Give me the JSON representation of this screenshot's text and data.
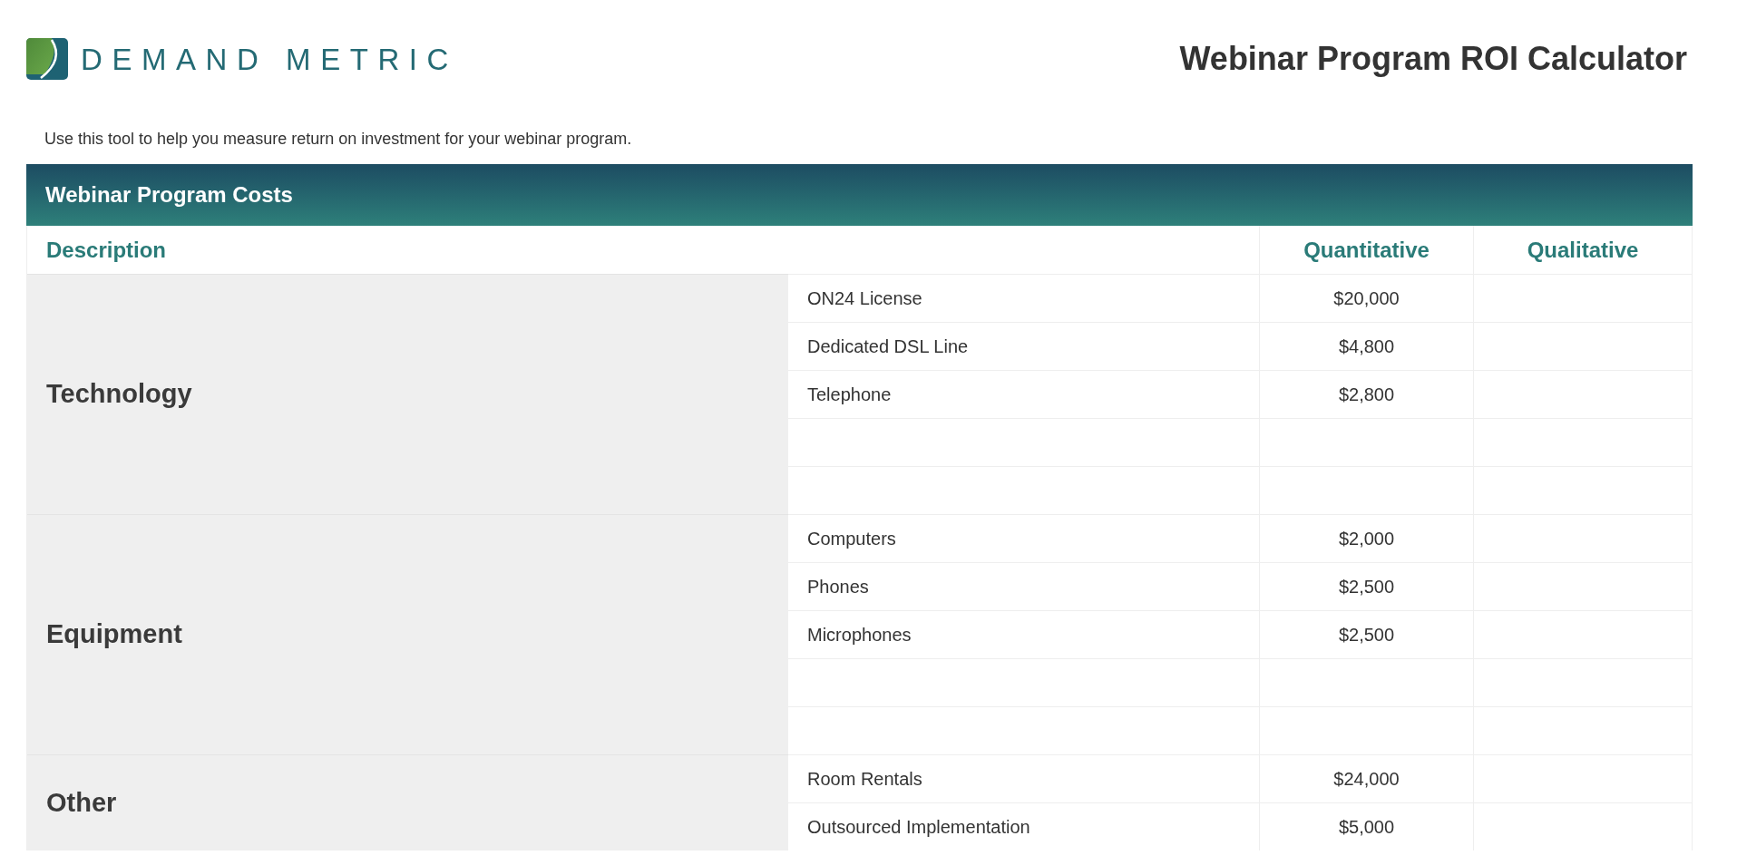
{
  "brand": {
    "name": "DEMAND METRIC"
  },
  "title": "Webinar Program ROI Calculator",
  "intro": "Use this tool to help you measure return on investment for your webinar program.",
  "section": {
    "title": "Webinar Program Costs",
    "columns": [
      "Description",
      "Quantitative",
      "Qualitative"
    ],
    "groups": [
      {
        "name": "Technology",
        "items": [
          {
            "kind": "entry",
            "name": "ON24 License",
            "quantitative": "$20,000"
          },
          {
            "kind": "entry",
            "name": "Dedicated DSL Line",
            "quantitative": "$4,800"
          },
          {
            "kind": "entry",
            "name": "Telephone",
            "quantitative": "$2,800"
          },
          {
            "kind": "blank"
          },
          {
            "kind": "blank"
          }
        ]
      },
      {
        "name": "Equipment",
        "items": [
          {
            "kind": "entry",
            "name": "Computers",
            "quantitative": "$2,000"
          },
          {
            "kind": "entry",
            "name": "Phones",
            "quantitative": "$2,500"
          },
          {
            "kind": "entry",
            "name": "Microphones",
            "quantitative": "$2,500"
          },
          {
            "kind": "blank"
          },
          {
            "kind": "blank"
          }
        ]
      },
      {
        "name": "Other",
        "items": [
          {
            "kind": "entry",
            "name": "Room Rentals",
            "quantitative": "$24,000"
          },
          {
            "kind": "entry",
            "name": "Outsourced Implementation",
            "quantitative": "$5,000"
          }
        ]
      }
    ]
  }
}
